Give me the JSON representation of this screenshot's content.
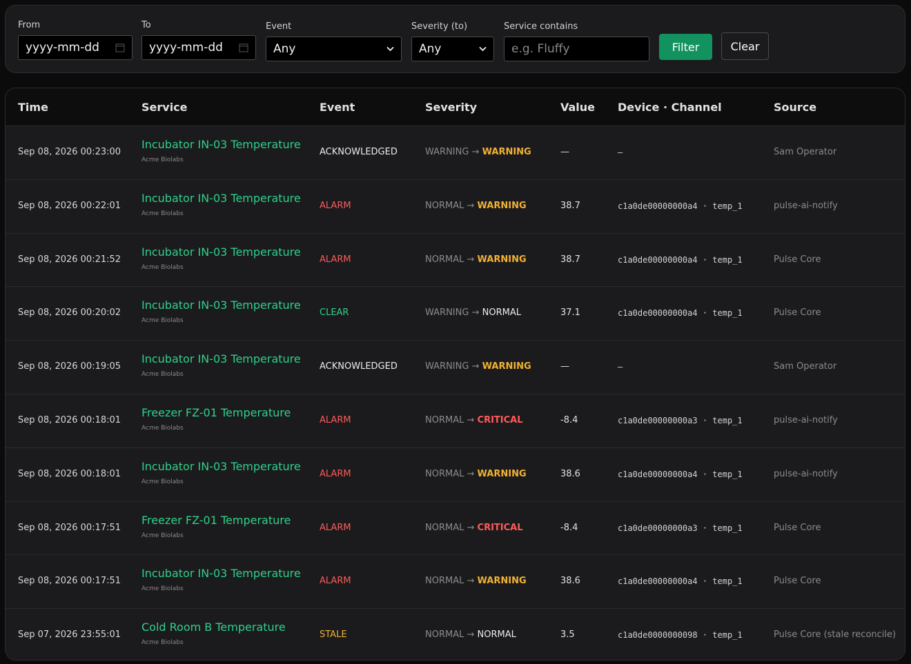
{
  "filters": {
    "from": {
      "label": "From",
      "placeholder": "yyyy-mm-dd"
    },
    "to": {
      "label": "To",
      "placeholder": "yyyy-mm-dd"
    },
    "event": {
      "label": "Event",
      "value": "Any"
    },
    "severity": {
      "label": "Severity (to)",
      "value": "Any"
    },
    "service": {
      "label": "Service contains",
      "placeholder": "e.g. Fluffy"
    },
    "filter_button": "Filter",
    "clear_button": "Clear"
  },
  "table": {
    "columns": [
      "Time",
      "Service",
      "Event",
      "Severity",
      "Value",
      "Device · Channel",
      "Source"
    ],
    "arrow": "→",
    "rows": [
      {
        "time": "Sep 08, 2026 00:23:00",
        "service": "Incubator IN-03 Temperature",
        "org": "Acme Biolabs",
        "event": "ACKNOWLEDGED",
        "sev_from": "WARNING",
        "sev_to": "WARNING",
        "value": "—",
        "device": "–",
        "source": "Sam Operator"
      },
      {
        "time": "Sep 08, 2026 00:22:01",
        "service": "Incubator IN-03 Temperature",
        "org": "Acme Biolabs",
        "event": "ALARM",
        "sev_from": "NORMAL",
        "sev_to": "WARNING",
        "value": "38.7",
        "device": "c1a0de00000000a4 · temp_1",
        "source": "pulse-ai-notify"
      },
      {
        "time": "Sep 08, 2026 00:21:52",
        "service": "Incubator IN-03 Temperature",
        "org": "Acme Biolabs",
        "event": "ALARM",
        "sev_from": "NORMAL",
        "sev_to": "WARNING",
        "value": "38.7",
        "device": "c1a0de00000000a4 · temp_1",
        "source": "Pulse Core"
      },
      {
        "time": "Sep 08, 2026 00:20:02",
        "service": "Incubator IN-03 Temperature",
        "org": "Acme Biolabs",
        "event": "CLEAR",
        "sev_from": "WARNING",
        "sev_to": "NORMAL",
        "value": "37.1",
        "device": "c1a0de00000000a4 · temp_1",
        "source": "Pulse Core"
      },
      {
        "time": "Sep 08, 2026 00:19:05",
        "service": "Incubator IN-03 Temperature",
        "org": "Acme Biolabs",
        "event": "ACKNOWLEDGED",
        "sev_from": "WARNING",
        "sev_to": "WARNING",
        "value": "—",
        "device": "–",
        "source": "Sam Operator"
      },
      {
        "time": "Sep 08, 2026 00:18:01",
        "service": "Freezer FZ-01 Temperature",
        "org": "Acme Biolabs",
        "event": "ALARM",
        "sev_from": "NORMAL",
        "sev_to": "CRITICAL",
        "value": "-8.4",
        "device": "c1a0de00000000a3 · temp_1",
        "source": "pulse-ai-notify"
      },
      {
        "time": "Sep 08, 2026 00:18:01",
        "service": "Incubator IN-03 Temperature",
        "org": "Acme Biolabs",
        "event": "ALARM",
        "sev_from": "NORMAL",
        "sev_to": "WARNING",
        "value": "38.6",
        "device": "c1a0de00000000a4 · temp_1",
        "source": "pulse-ai-notify"
      },
      {
        "time": "Sep 08, 2026 00:17:51",
        "service": "Freezer FZ-01 Temperature",
        "org": "Acme Biolabs",
        "event": "ALARM",
        "sev_from": "NORMAL",
        "sev_to": "CRITICAL",
        "value": "-8.4",
        "device": "c1a0de00000000a3 · temp_1",
        "source": "Pulse Core"
      },
      {
        "time": "Sep 08, 2026 00:17:51",
        "service": "Incubator IN-03 Temperature",
        "org": "Acme Biolabs",
        "event": "ALARM",
        "sev_from": "NORMAL",
        "sev_to": "WARNING",
        "value": "38.6",
        "device": "c1a0de00000000a4 · temp_1",
        "source": "Pulse Core"
      },
      {
        "time": "Sep 07, 2026 23:55:01",
        "service": "Cold Room B Temperature",
        "org": "Acme Biolabs",
        "event": "STALE",
        "sev_from": "NORMAL",
        "sev_to": "NORMAL",
        "value": "3.5",
        "device": "c1a0de0000000098 · temp_1",
        "source": "Pulse Core (stale reconcile)"
      }
    ]
  }
}
